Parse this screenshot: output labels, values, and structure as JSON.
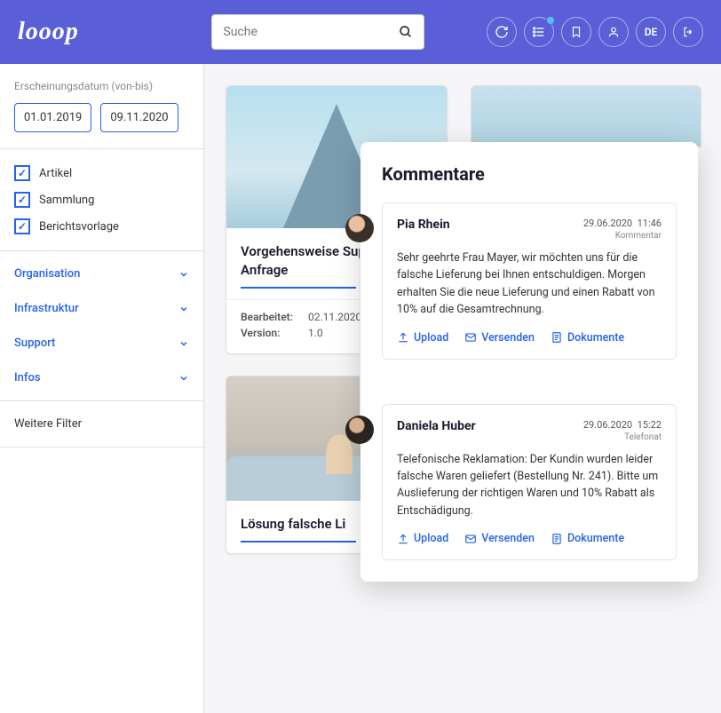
{
  "header": {
    "logo": "looop",
    "search_placeholder": "Suche",
    "language": "DE"
  },
  "sidebar": {
    "date_label": "Erscheinungsdatum (von-bis)",
    "date_from": "01.01.2019",
    "date_to": "09.11.2020",
    "checkboxes": [
      {
        "label": "Artikel",
        "checked": true
      },
      {
        "label": "Sammlung",
        "checked": true
      },
      {
        "label": "Berichtsvorlage",
        "checked": true
      }
    ],
    "accordions": [
      {
        "label": "Organisation"
      },
      {
        "label": "Infrastruktur"
      },
      {
        "label": "Support"
      },
      {
        "label": "Infos"
      }
    ],
    "more_filters": "Weitere Filter"
  },
  "cards": [
    {
      "title": "Vorgehensweise Support Anfrage",
      "edited_label": "Bearbeitet:",
      "edited_value": "02.11.2020",
      "version_label": "Version:",
      "version_value": "1.0"
    },
    {
      "title": "Lösung falsche Li"
    }
  ],
  "comments": {
    "title": "Kommentare",
    "items": [
      {
        "author": "Pia Rhein",
        "date": "29.06.2020",
        "time": "11:46",
        "type": "Kommentar",
        "body": "Sehr geehrte Frau Mayer, wir möchten uns für die falsche Lieferung bei Ihnen entschuldigen. Morgen erhalten Sie die neue Lieferung und einen Rabatt von 10% auf die Gesamtrechnung.",
        "actions": {
          "upload": "Upload",
          "send": "Versenden",
          "docs": "Dokumente"
        }
      },
      {
        "author": "Daniela Huber",
        "date": "29.06.2020",
        "time": "15:22",
        "type": "Telefonat",
        "body": "Telefonische Reklamation: Der Kundin wurden leider falsche Waren geliefert (Bestellung Nr. 241). Bitte um Auslieferung der richtigen Waren und 10% Rabatt als Entschädigung.",
        "actions": {
          "upload": "Upload",
          "send": "Versenden",
          "docs": "Dokumente"
        }
      }
    ]
  }
}
